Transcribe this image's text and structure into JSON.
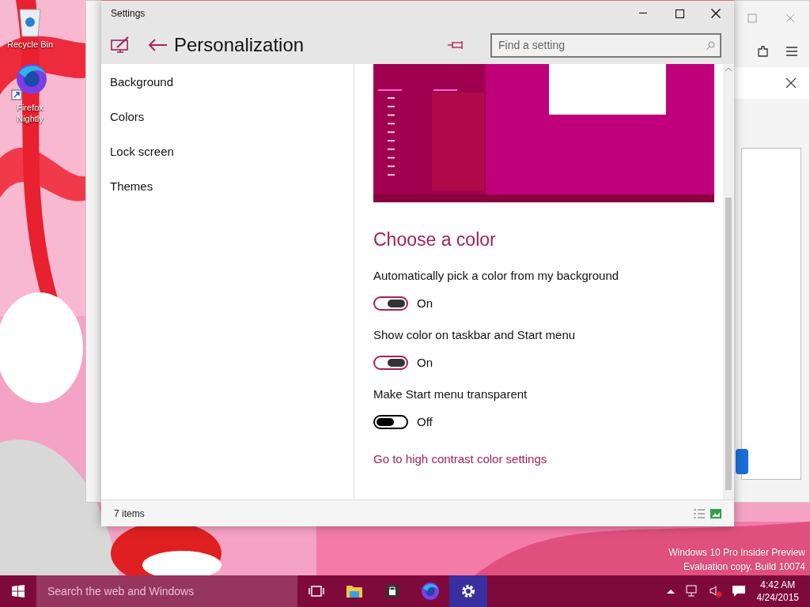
{
  "desktop_icons": [
    {
      "kind": "recycle-bin",
      "label": "Recycle Bin"
    },
    {
      "kind": "browser",
      "label": "Firefox Nightly"
    }
  ],
  "os_watermark": [
    "Windows 10 Pro Insider Preview",
    "Evaluation copy. Build 10074"
  ],
  "settings": {
    "title": "Settings",
    "header_title": "Personalization",
    "search": {
      "placeholder": "Find a setting"
    },
    "nav": [
      {
        "label": "Background"
      },
      {
        "label": "Colors"
      },
      {
        "label": "Lock screen"
      },
      {
        "label": "Themes"
      }
    ],
    "section_title": "Choose a color",
    "options": [
      {
        "label": "Automatically pick a color from my background",
        "on": true,
        "state_text": "On"
      },
      {
        "label": "Show color on taskbar and Start menu",
        "on": true,
        "state_text": "On"
      },
      {
        "label": "Make Start menu transparent",
        "on": false,
        "state_text": "Off"
      }
    ],
    "link": "Go to high contrast color settings",
    "status_text": "7 items"
  },
  "taskbar": {
    "search_placeholder": "Search the web and Windows",
    "apps": [
      {
        "kind": "task-view",
        "active": false
      },
      {
        "kind": "folder",
        "active": false
      },
      {
        "kind": "store",
        "active": false
      },
      {
        "kind": "browser",
        "active": false
      },
      {
        "kind": "gear",
        "active": true
      }
    ],
    "time": "4:42 AM",
    "date": "4/24/2015"
  }
}
